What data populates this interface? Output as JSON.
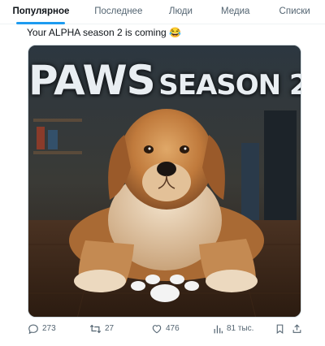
{
  "tabs": [
    {
      "label": "Популярное",
      "active": true
    },
    {
      "label": "Последнее",
      "active": false
    },
    {
      "label": "Люди",
      "active": false
    },
    {
      "label": "Медиа",
      "active": false
    },
    {
      "label": "Списки",
      "active": false
    }
  ],
  "tweet": {
    "text": "Your ALPHA season 2 is coming 😂",
    "image": {
      "title_word1": "PAWS",
      "title_word2": "SEASON 2"
    }
  },
  "actions": {
    "replies": "273",
    "reposts": "27",
    "likes": "476",
    "views": "81 тыс."
  },
  "colors": {
    "accent": "#1d9bf0",
    "muted": "#536471",
    "text": "#0f1419"
  },
  "icons": [
    "reply-icon",
    "repost-icon",
    "like-icon",
    "views-icon",
    "bookmark-icon",
    "share-icon"
  ]
}
